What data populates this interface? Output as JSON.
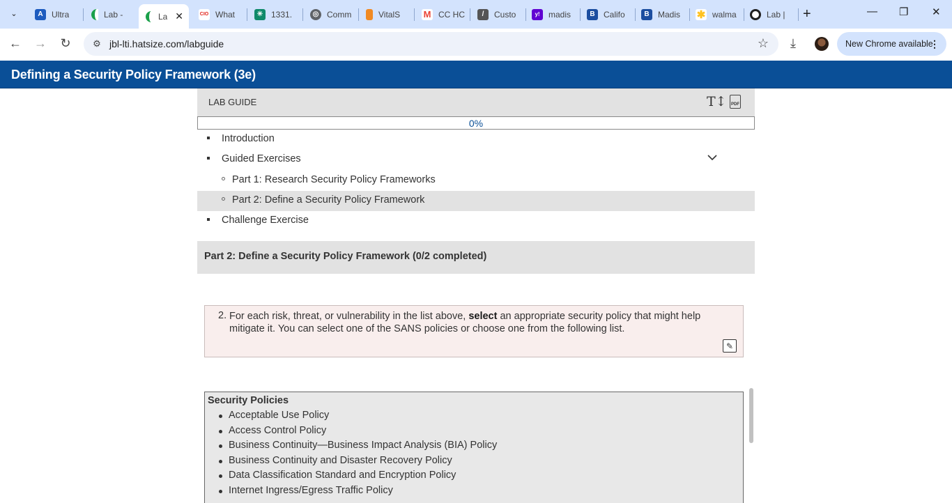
{
  "browser": {
    "tabs": [
      {
        "label": "Ultra",
        "fav_color": "#1c5bbf",
        "fav_glyph": "A"
      },
      {
        "label": "Lab -",
        "fav_color": "#1aa04a",
        "fav_glyph": ""
      },
      {
        "label": "La",
        "fav_color": "#1aa04a",
        "fav_glyph": "",
        "active": true
      },
      {
        "label": "What",
        "fav_color": "#e2231a",
        "fav_glyph": "CIO"
      },
      {
        "label": "1331.",
        "fav_color": "#0f8a6a",
        "fav_glyph": "✳"
      },
      {
        "label": "Comm",
        "fav_color": "#5f6368",
        "fav_glyph": "◎"
      },
      {
        "label": "VitalS",
        "fav_color": "#f08a24",
        "fav_glyph": "▮"
      },
      {
        "label": "CC HC",
        "fav_color": "#ea4335",
        "fav_glyph": "M"
      },
      {
        "label": "Custo",
        "fav_color": "#555555",
        "fav_glyph": "/"
      },
      {
        "label": "madis",
        "fav_color": "#6001d2",
        "fav_glyph": "y!"
      },
      {
        "label": "Califo",
        "fav_color": "#1c4ea0",
        "fav_glyph": "B"
      },
      {
        "label": "Madis",
        "fav_color": "#1c4ea0",
        "fav_glyph": "B"
      },
      {
        "label": "walma",
        "fav_color": "#ffc220",
        "fav_glyph": "✱"
      },
      {
        "label": "Lab |",
        "fav_color": "#1f1f1f",
        "fav_glyph": "○"
      }
    ],
    "active_tab_close": "✕",
    "new_tab": "+",
    "window_controls": {
      "minimize": "—",
      "restore": "❐",
      "close": "✕"
    },
    "url": "jbl-lti.hatsize.com/labguide",
    "update_chip": "New Chrome available"
  },
  "page": {
    "title": "Defining a Security Policy Framework (3e)"
  },
  "lab_guide": {
    "header": "LAB GUIDE",
    "progress_text": "0%",
    "progress_fraction": 0,
    "toc": {
      "introduction": "Introduction",
      "guided_exercises": "Guided Exercises",
      "part1": "Part 1: Research Security Policy Frameworks",
      "part2": "Part 2: Define a Security Policy Framework",
      "challenge": "Challenge Exercise"
    },
    "section_heading": "Part 2: Define a Security Policy Framework (0/2 completed)",
    "step": {
      "number": "2.",
      "text_before": "For each risk, threat, or vulnerability in the list above, ",
      "bold": "select",
      "text_after": " an appropriate security policy that might help mitigate it. You can select one of the SANS policies or choose one from the following list."
    },
    "policies": {
      "title": "Security Policies",
      "items": [
        "Acceptable Use Policy",
        "Access Control Policy",
        "Business Continuity—Business Impact Analysis (BIA) Policy",
        "Business Continuity and Disaster Recovery Policy",
        "Data Classification Standard and Encryption Policy",
        "Internet Ingress/Egress Traffic Policy"
      ]
    }
  }
}
